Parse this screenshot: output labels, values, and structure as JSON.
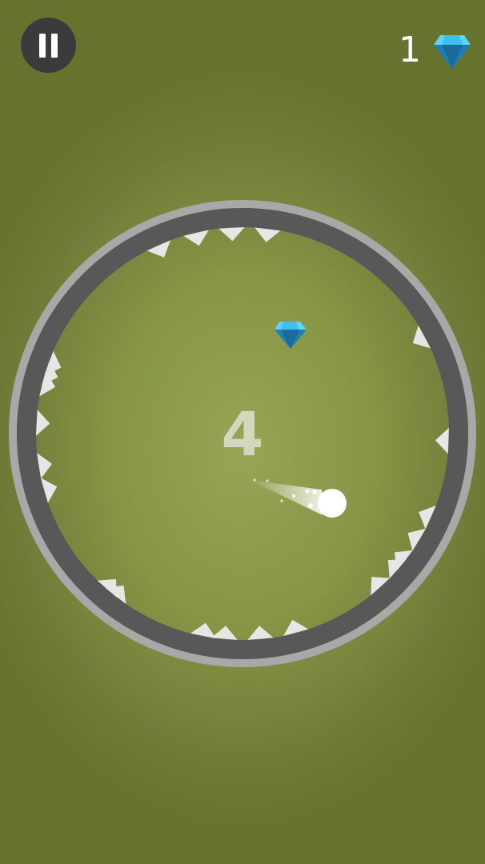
{
  "hud": {
    "pause_icon": "pause-icon",
    "gem_count": "1",
    "gem_icon": "diamond-icon",
    "gem_color": "#29a9e1"
  },
  "game": {
    "score": "4",
    "colors": {
      "background": "#879546",
      "ring_outer": "#a8a8a8",
      "ring_inner": "#585858",
      "spike": "#e6e6e6",
      "ball": "#ffffff"
    }
  }
}
